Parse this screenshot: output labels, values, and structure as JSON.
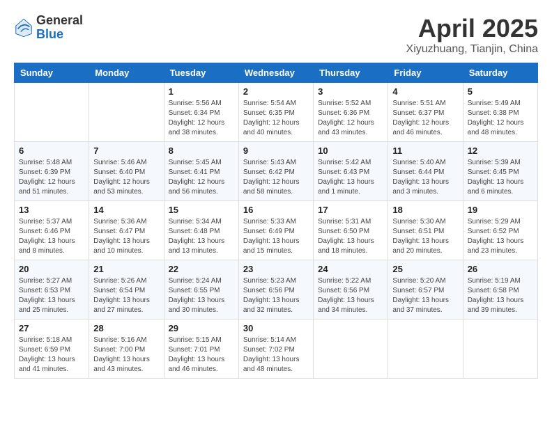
{
  "header": {
    "logo_general": "General",
    "logo_blue": "Blue",
    "title": "April 2025",
    "location": "Xiyuzhuang, Tianjin, China"
  },
  "weekdays": [
    "Sunday",
    "Monday",
    "Tuesday",
    "Wednesday",
    "Thursday",
    "Friday",
    "Saturday"
  ],
  "weeks": [
    [
      {
        "day": "",
        "info": ""
      },
      {
        "day": "",
        "info": ""
      },
      {
        "day": "1",
        "info": "Sunrise: 5:56 AM\nSunset: 6:34 PM\nDaylight: 12 hours and 38 minutes."
      },
      {
        "day": "2",
        "info": "Sunrise: 5:54 AM\nSunset: 6:35 PM\nDaylight: 12 hours and 40 minutes."
      },
      {
        "day": "3",
        "info": "Sunrise: 5:52 AM\nSunset: 6:36 PM\nDaylight: 12 hours and 43 minutes."
      },
      {
        "day": "4",
        "info": "Sunrise: 5:51 AM\nSunset: 6:37 PM\nDaylight: 12 hours and 46 minutes."
      },
      {
        "day": "5",
        "info": "Sunrise: 5:49 AM\nSunset: 6:38 PM\nDaylight: 12 hours and 48 minutes."
      }
    ],
    [
      {
        "day": "6",
        "info": "Sunrise: 5:48 AM\nSunset: 6:39 PM\nDaylight: 12 hours and 51 minutes."
      },
      {
        "day": "7",
        "info": "Sunrise: 5:46 AM\nSunset: 6:40 PM\nDaylight: 12 hours and 53 minutes."
      },
      {
        "day": "8",
        "info": "Sunrise: 5:45 AM\nSunset: 6:41 PM\nDaylight: 12 hours and 56 minutes."
      },
      {
        "day": "9",
        "info": "Sunrise: 5:43 AM\nSunset: 6:42 PM\nDaylight: 12 hours and 58 minutes."
      },
      {
        "day": "10",
        "info": "Sunrise: 5:42 AM\nSunset: 6:43 PM\nDaylight: 13 hours and 1 minute."
      },
      {
        "day": "11",
        "info": "Sunrise: 5:40 AM\nSunset: 6:44 PM\nDaylight: 13 hours and 3 minutes."
      },
      {
        "day": "12",
        "info": "Sunrise: 5:39 AM\nSunset: 6:45 PM\nDaylight: 13 hours and 6 minutes."
      }
    ],
    [
      {
        "day": "13",
        "info": "Sunrise: 5:37 AM\nSunset: 6:46 PM\nDaylight: 13 hours and 8 minutes."
      },
      {
        "day": "14",
        "info": "Sunrise: 5:36 AM\nSunset: 6:47 PM\nDaylight: 13 hours and 10 minutes."
      },
      {
        "day": "15",
        "info": "Sunrise: 5:34 AM\nSunset: 6:48 PM\nDaylight: 13 hours and 13 minutes."
      },
      {
        "day": "16",
        "info": "Sunrise: 5:33 AM\nSunset: 6:49 PM\nDaylight: 13 hours and 15 minutes."
      },
      {
        "day": "17",
        "info": "Sunrise: 5:31 AM\nSunset: 6:50 PM\nDaylight: 13 hours and 18 minutes."
      },
      {
        "day": "18",
        "info": "Sunrise: 5:30 AM\nSunset: 6:51 PM\nDaylight: 13 hours and 20 minutes."
      },
      {
        "day": "19",
        "info": "Sunrise: 5:29 AM\nSunset: 6:52 PM\nDaylight: 13 hours and 23 minutes."
      }
    ],
    [
      {
        "day": "20",
        "info": "Sunrise: 5:27 AM\nSunset: 6:53 PM\nDaylight: 13 hours and 25 minutes."
      },
      {
        "day": "21",
        "info": "Sunrise: 5:26 AM\nSunset: 6:54 PM\nDaylight: 13 hours and 27 minutes."
      },
      {
        "day": "22",
        "info": "Sunrise: 5:24 AM\nSunset: 6:55 PM\nDaylight: 13 hours and 30 minutes."
      },
      {
        "day": "23",
        "info": "Sunrise: 5:23 AM\nSunset: 6:56 PM\nDaylight: 13 hours and 32 minutes."
      },
      {
        "day": "24",
        "info": "Sunrise: 5:22 AM\nSunset: 6:56 PM\nDaylight: 13 hours and 34 minutes."
      },
      {
        "day": "25",
        "info": "Sunrise: 5:20 AM\nSunset: 6:57 PM\nDaylight: 13 hours and 37 minutes."
      },
      {
        "day": "26",
        "info": "Sunrise: 5:19 AM\nSunset: 6:58 PM\nDaylight: 13 hours and 39 minutes."
      }
    ],
    [
      {
        "day": "27",
        "info": "Sunrise: 5:18 AM\nSunset: 6:59 PM\nDaylight: 13 hours and 41 minutes."
      },
      {
        "day": "28",
        "info": "Sunrise: 5:16 AM\nSunset: 7:00 PM\nDaylight: 13 hours and 43 minutes."
      },
      {
        "day": "29",
        "info": "Sunrise: 5:15 AM\nSunset: 7:01 PM\nDaylight: 13 hours and 46 minutes."
      },
      {
        "day": "30",
        "info": "Sunrise: 5:14 AM\nSunset: 7:02 PM\nDaylight: 13 hours and 48 minutes."
      },
      {
        "day": "",
        "info": ""
      },
      {
        "day": "",
        "info": ""
      },
      {
        "day": "",
        "info": ""
      }
    ]
  ]
}
